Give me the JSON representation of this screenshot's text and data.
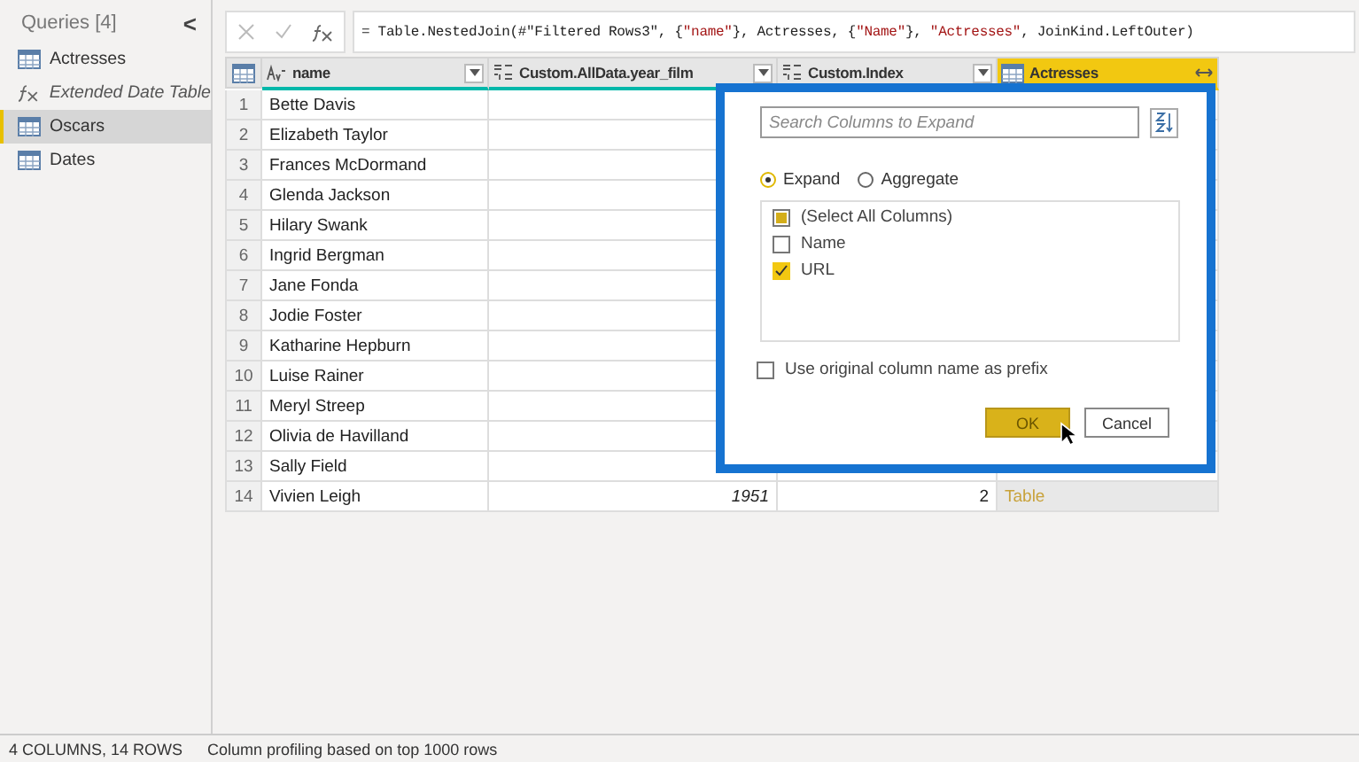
{
  "sidebar": {
    "title": "Queries [4]",
    "collapse": "<",
    "items": [
      {
        "label": "Actresses",
        "kind": "table",
        "selected": false
      },
      {
        "label": "Extended Date Table",
        "kind": "function",
        "selected": false
      },
      {
        "label": "Oscars",
        "kind": "table",
        "selected": true
      },
      {
        "label": "Dates",
        "kind": "table",
        "selected": false
      }
    ]
  },
  "formula_bar": {
    "tokens": [
      {
        "text": "= Table.NestedJoin(#\"Filtered Rows3\", {",
        "kind": "plain"
      },
      {
        "text": "\"name\"",
        "kind": "string"
      },
      {
        "text": "}, Actresses, {",
        "kind": "plain"
      },
      {
        "text": "\"Name\"",
        "kind": "string"
      },
      {
        "text": "}, ",
        "kind": "plain"
      },
      {
        "text": "\"Actresses\"",
        "kind": "string"
      },
      {
        "text": ", JoinKind.LeftOuter)",
        "kind": "plain"
      }
    ]
  },
  "table": {
    "columns": [
      {
        "label": "name",
        "kind": "text",
        "selected": false
      },
      {
        "label": "Custom.AllData.year_film",
        "kind": "any",
        "selected": false
      },
      {
        "label": "Custom.Index",
        "kind": "any",
        "selected": false
      },
      {
        "label": "Actresses",
        "kind": "table",
        "selected": true
      }
    ],
    "rows": [
      {
        "number": "1",
        "name": "Bette Davis"
      },
      {
        "number": "2",
        "name": "Elizabeth Taylor"
      },
      {
        "number": "3",
        "name": "Frances McDormand"
      },
      {
        "number": "4",
        "name": "Glenda Jackson"
      },
      {
        "number": "5",
        "name": "Hilary Swank"
      },
      {
        "number": "6",
        "name": "Ingrid Bergman"
      },
      {
        "number": "7",
        "name": "Jane Fonda"
      },
      {
        "number": "8",
        "name": "Jodie Foster"
      },
      {
        "number": "9",
        "name": "Katharine Hepburn"
      },
      {
        "number": "10",
        "name": "Luise Rainer"
      },
      {
        "number": "11",
        "name": "Meryl Streep"
      },
      {
        "number": "12",
        "name": "Olivia de Havilland"
      },
      {
        "number": "13",
        "name": "Sally Field"
      },
      {
        "number": "14",
        "name": "Vivien Leigh",
        "year": "1951",
        "index": "2",
        "actresses": "Table"
      }
    ]
  },
  "expand_dialog": {
    "search": {
      "placeholder": "Search Columns to Expand"
    },
    "modes": [
      {
        "label": "Expand",
        "selected": true
      },
      {
        "label": "Aggregate",
        "selected": false
      }
    ],
    "columns": [
      {
        "label": "(Select All Columns)",
        "checked": false,
        "indeterminate": true
      },
      {
        "label": "Name",
        "checked": false,
        "indeterminate": false
      },
      {
        "label": "URL",
        "checked": true,
        "indeterminate": false
      }
    ],
    "prefix": {
      "label": "Use original column name as prefix",
      "checked": false
    },
    "buttons": [
      {
        "label": "OK",
        "kind": "primary"
      },
      {
        "label": "Cancel",
        "kind": "secondary"
      }
    ]
  },
  "status_bar": {
    "counts": "4 COLUMNS, 14 ROWS",
    "profiling": "Column profiling based on top 1000 rows"
  }
}
